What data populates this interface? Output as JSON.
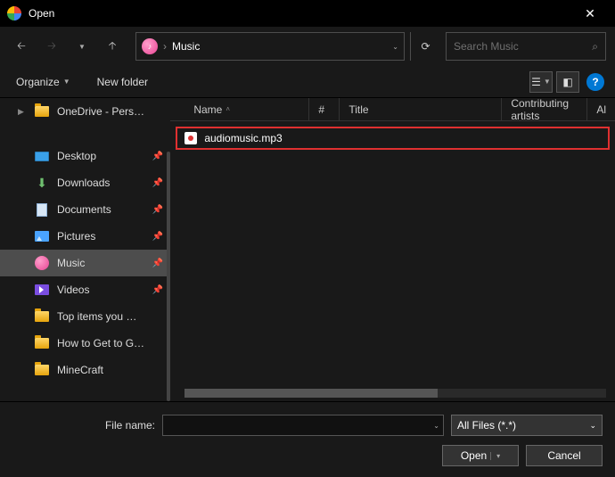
{
  "window": {
    "title": "Open"
  },
  "address": {
    "crumb": "Music"
  },
  "search": {
    "placeholder": "Search Music"
  },
  "toolbar": {
    "organize": "Organize",
    "newfolder": "New folder"
  },
  "sidebar": {
    "items": [
      {
        "label": "OneDrive - Personal",
        "kind": "cloud",
        "pin": false
      },
      {
        "label": "Desktop",
        "kind": "desktop",
        "pin": true
      },
      {
        "label": "Downloads",
        "kind": "down",
        "pin": true
      },
      {
        "label": "Documents",
        "kind": "doc",
        "pin": true
      },
      {
        "label": "Pictures",
        "kind": "pic",
        "pin": true
      },
      {
        "label": "Music",
        "kind": "music",
        "pin": true,
        "selected": true
      },
      {
        "label": "Videos",
        "kind": "video",
        "pin": true
      },
      {
        "label": "Top items you MUST get t",
        "kind": "folder",
        "pin": false
      },
      {
        "label": "How to Get to Ganondorf",
        "kind": "folder",
        "pin": false
      },
      {
        "label": "MineCraft",
        "kind": "folder",
        "pin": false
      }
    ]
  },
  "columns": {
    "name": "Name",
    "num": "#",
    "title": "Title",
    "artist": "Contributing artists",
    "last": "Al"
  },
  "files": [
    {
      "name": "audiomusic.mp3"
    }
  ],
  "footer": {
    "filename_label": "File name:",
    "filename_value": "",
    "filter": "All Files (*.*)",
    "open": "Open",
    "cancel": "Cancel"
  }
}
